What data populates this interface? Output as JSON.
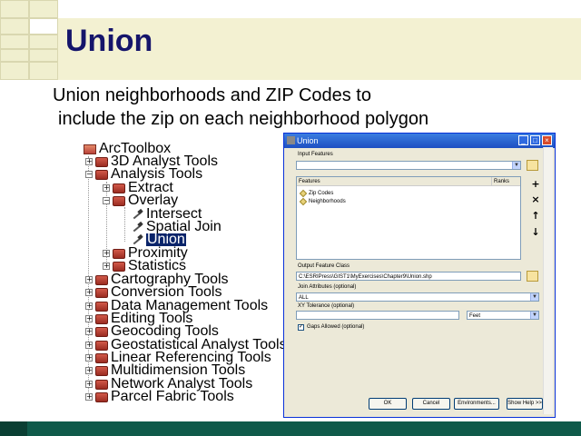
{
  "slide": {
    "title": "Union",
    "subtitle_line1": "Union neighborhoods and ZIP Codes to",
    "subtitle_line2": "include the zip on each neighborhood polygon"
  },
  "toolbox": {
    "root": "ArcToolbox",
    "items": [
      {
        "label": "3D Analyst Tools",
        "expander": "+"
      },
      {
        "label": "Analysis Tools",
        "expander": "−"
      },
      {
        "label": "Extract",
        "expander": "+"
      },
      {
        "label": "Overlay",
        "expander": "−"
      },
      {
        "label": "Intersect"
      },
      {
        "label": "Spatial Join"
      },
      {
        "label": "Union",
        "selected": true
      },
      {
        "label": "Proximity",
        "expander": "+"
      },
      {
        "label": "Statistics",
        "expander": "+"
      },
      {
        "label": "Cartography Tools",
        "expander": "+"
      },
      {
        "label": "Conversion Tools",
        "expander": "+"
      },
      {
        "label": "Data Management Tools",
        "expander": "+"
      },
      {
        "label": "Editing Tools",
        "expander": "+"
      },
      {
        "label": "Geocoding Tools",
        "expander": "+"
      },
      {
        "label": "Geostatistical Analyst Tools",
        "expander": "+"
      },
      {
        "label": "Linear Referencing Tools",
        "expander": "+"
      },
      {
        "label": "Multidimension Tools",
        "expander": "+"
      },
      {
        "label": "Network Analyst Tools",
        "expander": "+"
      },
      {
        "label": "Parcel Fabric Tools",
        "expander": "+"
      }
    ]
  },
  "dialog": {
    "title": "Union",
    "input_features_label": "Input Features",
    "features_col": "Features",
    "ranks_col": "Ranks",
    "features": [
      "Zip Codes",
      "Neighborhoods"
    ],
    "output_label": "Output Feature Class",
    "output_value": "C:\\ESRIPress\\GIST1\\MyExercises\\Chapter9\\Union.shp",
    "join_attr_label": "Join Attributes (optional)",
    "join_attr_value": "ALL",
    "xy_tol_label": "XY Tolerance (optional)",
    "xy_tol_unit": "Feet",
    "gaps_label": "Gaps Allowed (optional)",
    "gaps_checked": "✓",
    "buttons": {
      "ok": "OK",
      "cancel": "Cancel",
      "environments": "Environments...",
      "show_help": "Show Help >>"
    },
    "side_buttons": [
      "+",
      "×",
      "↑",
      "↓"
    ]
  }
}
